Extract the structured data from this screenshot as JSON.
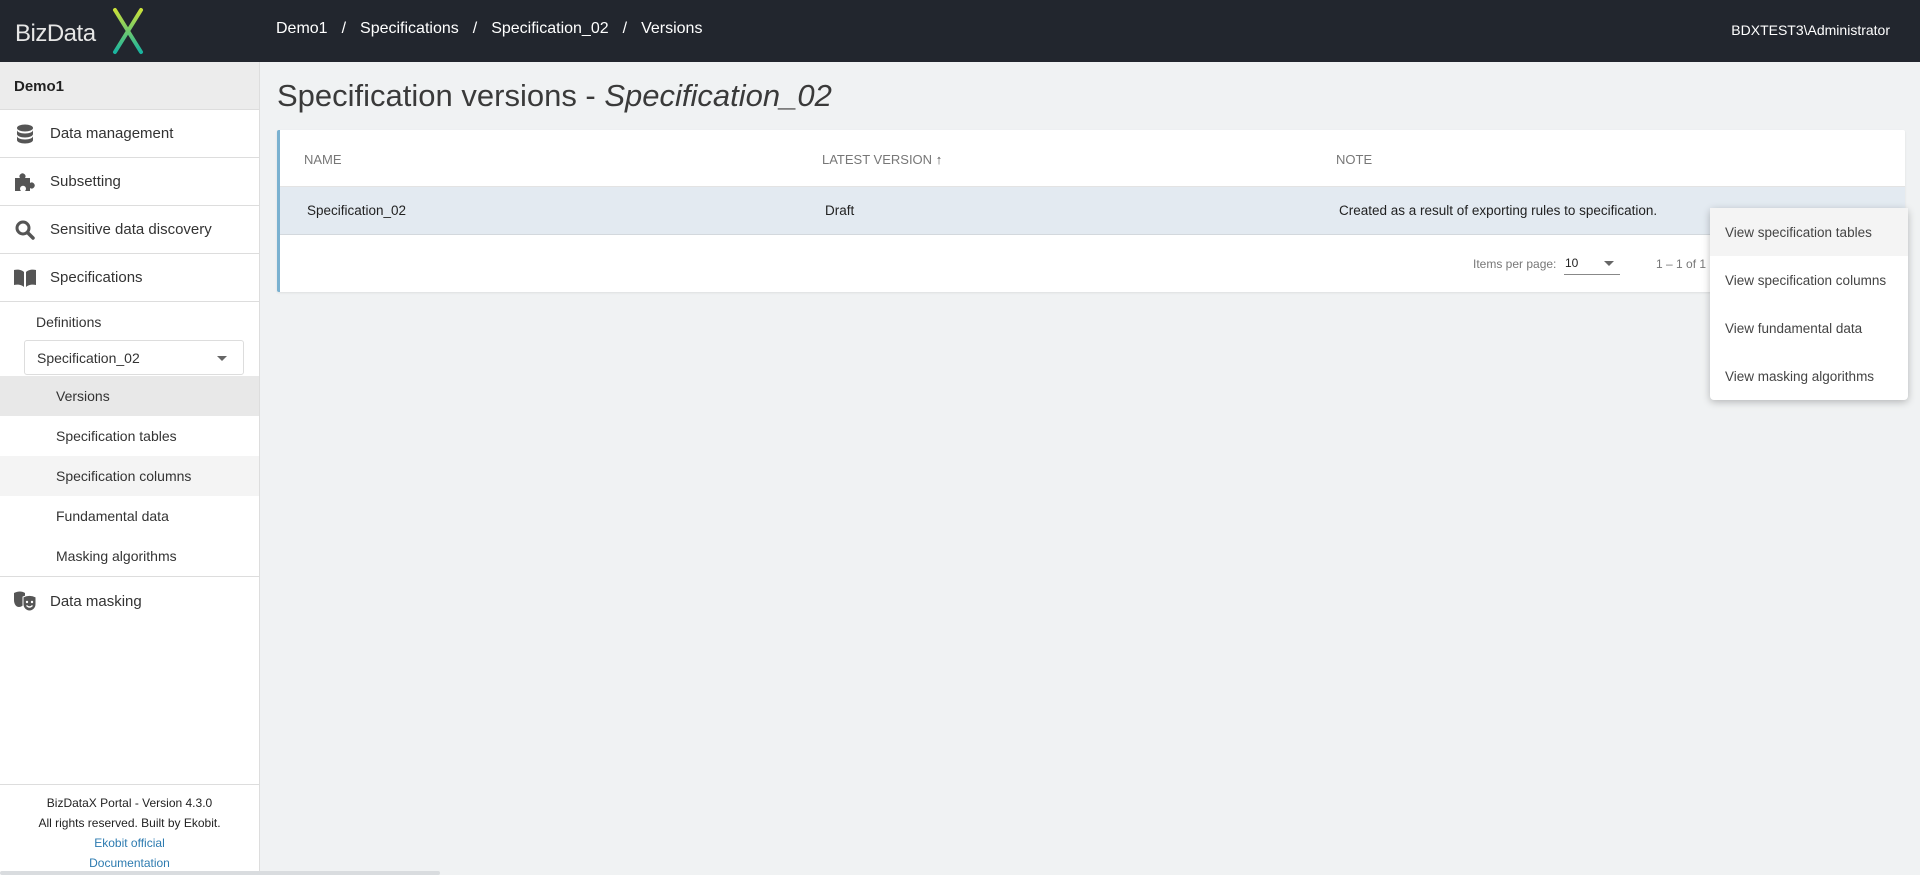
{
  "header": {
    "logo_text": "BizData",
    "logo_x": "X",
    "breadcrumb": [
      "Demo1",
      "Specifications",
      "Specification_02",
      "Versions"
    ],
    "separator": "/",
    "user": "BDXTEST3\\Administrator"
  },
  "sidebar": {
    "project": "Demo1",
    "items": [
      {
        "label": "Data management",
        "icon": "database-icon"
      },
      {
        "label": "Subsetting",
        "icon": "puzzle-icon"
      },
      {
        "label": "Sensitive data discovery",
        "icon": "search-icon"
      },
      {
        "label": "Specifications",
        "icon": "book-icon"
      }
    ],
    "definitions_label": "Definitions",
    "spec_select": "Specification_02",
    "sub_items": [
      "Versions",
      "Specification tables",
      "Specification columns",
      "Fundamental data",
      "Masking algorithms"
    ],
    "masking": {
      "label": "Data masking",
      "icon": "masks-icon"
    },
    "footer": {
      "version": "BizDataX Portal - Version 4.3.0",
      "rights": "All rights reserved. Built by Ekobit.",
      "link1": "Ekobit official",
      "link2": "Documentation"
    }
  },
  "main": {
    "title_prefix": "Specification versions - ",
    "title_name": "Specification_02",
    "table": {
      "columns": [
        "NAME",
        "LATEST VERSION",
        "NOTE"
      ],
      "sort_icon": "↑",
      "rows": [
        [
          "Specification_02",
          "Draft",
          "Created as a result of exporting rules to specification."
        ]
      ]
    },
    "pagination": {
      "items_per_page_label": "Items per page:",
      "items_per_page": "10",
      "range": "1 – 1 of 1"
    }
  },
  "context_menu": [
    "View specification tables",
    "View specification columns",
    "View fundamental data",
    "View masking algorithms"
  ],
  "colors": {
    "header_bg": "#22262e",
    "accent": "#7ab1d0",
    "row_bg": "#e3eaf1",
    "link": "#2d7bb0"
  }
}
